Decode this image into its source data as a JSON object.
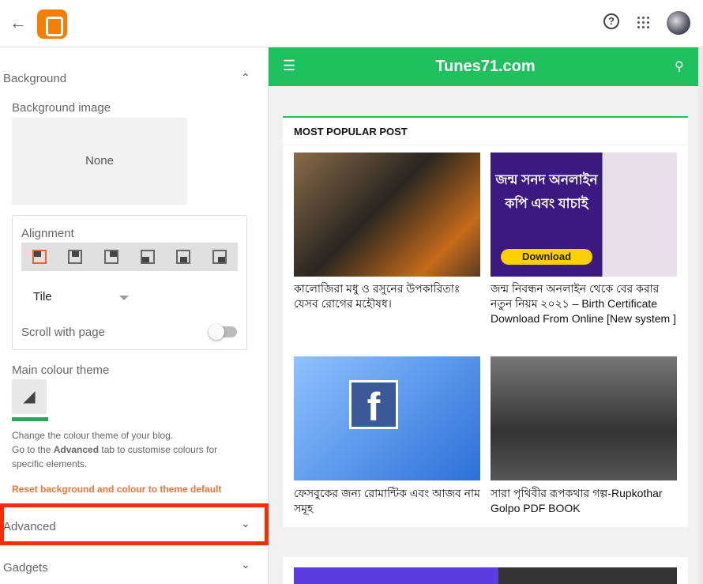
{
  "topbar": {
    "back_icon": "arrow-left-icon",
    "logo": "blogger-logo",
    "help_icon": "help-circle-icon",
    "apps_icon": "apps-grid-icon"
  },
  "sidebar": {
    "background_section": "Background",
    "background_image_label": "Background image",
    "background_image_value": "None",
    "alignment_label": "Alignment",
    "alignment_selected": "top-left",
    "tile_value": "Tile",
    "scroll_with_page_label": "Scroll with page",
    "scroll_with_page_on": false,
    "main_colour_label": "Main colour theme",
    "main_colour": "#27a660",
    "help_line1": "Change the colour theme of your blog.",
    "help_line2_pre": "Go to the ",
    "help_line2_bold": "Advanced",
    "help_line2_post": " tab to customise colours for specific elements.",
    "reset_link": "Reset background and colour to theme default",
    "advanced_section": "Advanced",
    "gadgets_section": "Gadgets",
    "highlight_color": "#ff2a00"
  },
  "preview": {
    "site_title": "Tunes71.com",
    "nav_color": "#1fc15e",
    "popular_heading": "MOST POPULAR POST",
    "posts": [
      {
        "title": "কালোজিরা মধু ও রসুনের উপকারিতাঃ যেসব রোগের মহৌষধ।"
      },
      {
        "title": "জন্ম নিবন্ধন অনলাইন থেকে বের করার নতুন নিয়ম ২০২১ – Birth Certificate Download From Online [New system ]",
        "image_text": "জন্ম সনদ অনলাইন কপি এবং যাচাই",
        "image_button": "Download"
      },
      {
        "title": "ফেসবুকের জন্য রোমান্টিক এবং আজব নাম সমূহ"
      },
      {
        "title": "সারা পৃথিবীর রূপকথার গল্প-Rupkothar Golpo PDF BOOK"
      }
    ]
  }
}
